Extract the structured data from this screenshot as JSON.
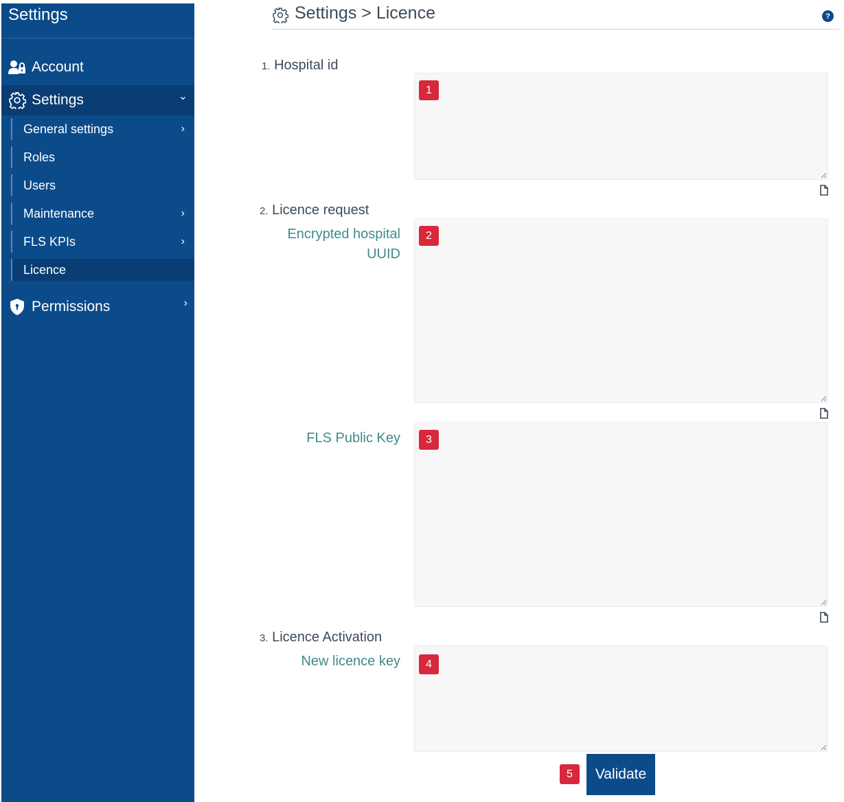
{
  "sidebar": {
    "title": "Settings",
    "account": "Account",
    "settings": "Settings",
    "sub_items": {
      "general": "General settings",
      "roles": "Roles",
      "users": "Users",
      "maintenance": "Maintenance",
      "kpis": "FLS KPIs",
      "licence": "Licence"
    },
    "permissions": "Permissions",
    "chevron_right": "›",
    "chevron_down": "⌄"
  },
  "header": {
    "title": "Settings > Licence",
    "help": "?"
  },
  "form": {
    "step1": {
      "num": "1.",
      "label": "Hospital id"
    },
    "step2": {
      "num": "2.",
      "label": "Licence request"
    },
    "step3": {
      "num": "3.",
      "label": "Licence Activation"
    },
    "field_encrypted_uuid": "Encrypted hospital UUID",
    "field_public_key": "FLS Public Key",
    "field_new_key": "New licence key",
    "badges": [
      "1",
      "2",
      "3",
      "4",
      "5"
    ],
    "validate": "Validate"
  },
  "colors": {
    "sidebar": "#0c4b8a",
    "active": "#0a3d73",
    "badge": "#d8283c",
    "field_label": "#3f8a8a"
  }
}
